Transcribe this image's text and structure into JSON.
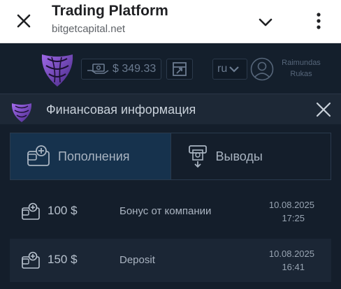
{
  "browser": {
    "title": "Trading Platform",
    "url": "bitgetcapital.net"
  },
  "header": {
    "balance": "$ 349.33",
    "language": "ru",
    "user_first": "Raimundas",
    "user_last": "Rukas"
  },
  "modal": {
    "title": "Финансовая информация",
    "tabs": [
      {
        "label": "Пополнения",
        "active": true,
        "icon": "wallet-plus-icon"
      },
      {
        "label": "Выводы",
        "active": false,
        "icon": "atm-withdraw-icon"
      }
    ],
    "transactions": [
      {
        "amount": "100 $",
        "description": "Бонус от компании",
        "date": "10.08.2025",
        "time": "17:25"
      },
      {
        "amount": "150 $",
        "description": "Deposit",
        "date": "10.08.2025",
        "time": "16:41"
      }
    ]
  },
  "colors": {
    "background": "#0f1a27",
    "active_tab": "#16324d",
    "accent_purple": "#7b4bc4"
  }
}
